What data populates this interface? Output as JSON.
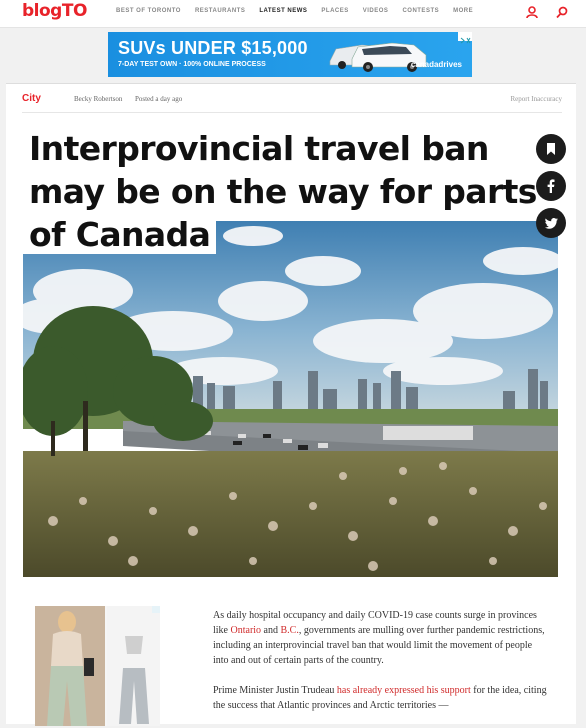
{
  "site": {
    "logo": "blogTO"
  },
  "nav": {
    "items": [
      {
        "label": "BEST OF TORONTO",
        "active": false
      },
      {
        "label": "RESTAURANTS",
        "active": false
      },
      {
        "label": "LATEST NEWS",
        "active": true
      },
      {
        "label": "PLACES",
        "active": false
      },
      {
        "label": "VIDEOS",
        "active": false
      },
      {
        "label": "CONTESTS",
        "active": false
      },
      {
        "label": "MORE",
        "active": false
      }
    ],
    "icons": [
      "user-icon",
      "search-icon"
    ]
  },
  "ad_banner": {
    "headline": "SUVs UNDER $15,000",
    "sub": "7-DAY TEST OWN · 100% ONLINE PROCESS",
    "brand": "canadadrives"
  },
  "article": {
    "category": "City",
    "author": "Becky Robertson",
    "posted": "Posted a day ago",
    "report": "Report Inaccuracy",
    "title": "Interprovincial travel ban may be on the way for parts of Canada",
    "paragraphs": [
      {
        "t1": "As daily hospital occupancy and daily COVID-19 case counts surge in provinces like ",
        "l1": "Ontario",
        "t2": " and ",
        "l2": "B.C.",
        "t3": ", governments are mulling over further pandemic restrictions, including an interprovincial travel ban that would limit the movement of people into and out of certain parts of the country."
      },
      {
        "t1": "Prime Minister Justin Trudeau ",
        "l1": "has already expressed his support",
        "t2": " for the idea, citing the success that Atlantic provinces and Arctic territories —"
      }
    ]
  },
  "colors": {
    "brand_red": "#e8232a",
    "link": "#d02b2b",
    "ad_blue": "#1a8fe0"
  }
}
